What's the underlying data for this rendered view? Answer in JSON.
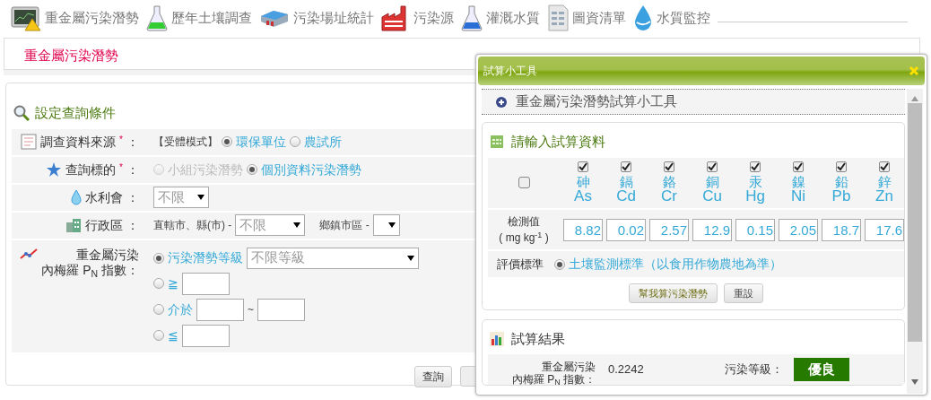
{
  "nav": [
    {
      "label": "重金屬污染潛勢"
    },
    {
      "label": "歷年土壤調查"
    },
    {
      "label": "污染場址統計"
    },
    {
      "label": "污染源"
    },
    {
      "label": "灌溉水質"
    },
    {
      "label": "圖資清單"
    },
    {
      "label": "水質監控"
    }
  ],
  "page_title": "重金屬污染潛勢",
  "query_panel": {
    "heading": "設定查詢條件",
    "rows": [
      {
        "kind": "radios",
        "label": "調查資料來源",
        "required_mark": "*",
        "colon": "：",
        "note": "【受體模式】",
        "options": [
          {
            "label": "環保單位",
            "selected": true,
            "disabled": false
          },
          {
            "label": "農試所",
            "selected": false,
            "disabled": false
          }
        ]
      },
      {
        "kind": "radios",
        "label": "查詢標的",
        "required_mark": "*",
        "colon": "：",
        "options": [
          {
            "label": "小組污染潛勢",
            "selected": false,
            "disabled": true
          },
          {
            "label": "個別資料污染潛勢",
            "selected": true,
            "disabled": false
          }
        ]
      },
      {
        "kind": "select",
        "label": "水利會",
        "colon": "：",
        "value": "不限"
      },
      {
        "kind": "district",
        "label": "行政區",
        "colon": "：",
        "county_label": "直轄市、縣(市) -",
        "county_value": "不限",
        "town_label": "鄉鎮市區 -"
      },
      {
        "kind": "pn",
        "label_lines": [
          "重金屬污染",
          "內梅羅 P$_{N}$ 指數"
        ],
        "colon": "：",
        "options": [
          {
            "kind": "select",
            "label": "污染潛勢等級",
            "value": "不限等級",
            "selected": true
          },
          {
            "kind": "gte",
            "label": "≧",
            "selected": false
          },
          {
            "kind": "between",
            "label": "介於",
            "separator": "~",
            "selected": false
          },
          {
            "kind": "lte",
            "label": "≦",
            "selected": false
          }
        ]
      }
    ],
    "query_button": "查詢"
  },
  "calculator": {
    "title": "試算小工具",
    "tool_heading": "重金屬污染潛勢試算小工具",
    "input_section": {
      "heading": "請輸入試算資料",
      "select_all_checked": false,
      "elements": [
        {
          "name": "砷",
          "symbol": "As",
          "checked": true,
          "value": "8.82"
        },
        {
          "name": "鎘",
          "symbol": "Cd",
          "checked": true,
          "value": "0.02"
        },
        {
          "name": "鉻",
          "symbol": "Cr",
          "checked": true,
          "value": "2.57"
        },
        {
          "name": "銅",
          "symbol": "Cu",
          "checked": true,
          "value": "12.9"
        },
        {
          "name": "汞",
          "symbol": "Hg",
          "checked": true,
          "value": "0.15"
        },
        {
          "name": "鎳",
          "symbol": "Ni",
          "checked": true,
          "value": "2.05"
        },
        {
          "name": "鉛",
          "symbol": "Pb",
          "checked": true,
          "value": "18.7"
        },
        {
          "name": "鋅",
          "symbol": "Zn",
          "checked": true,
          "value": "17.6"
        }
      ],
      "value_label_lines": [
        "檢測值",
        "( mg kg$^{-1}$ )"
      ],
      "standard_label": "評價標準",
      "standard_option": {
        "label": "土壤監測標準（以食用作物農地為準）",
        "selected": true
      },
      "buttons": [
        "幫我算污染潛勢",
        "重設"
      ]
    },
    "result_section": {
      "heading": "試算結果",
      "index_label_lines": [
        "重金屬污染",
        "內梅羅 P$_{N}$ 指數："
      ],
      "index_value": "0.2242",
      "grade_label": "污染等級：",
      "grade": "優良"
    }
  }
}
